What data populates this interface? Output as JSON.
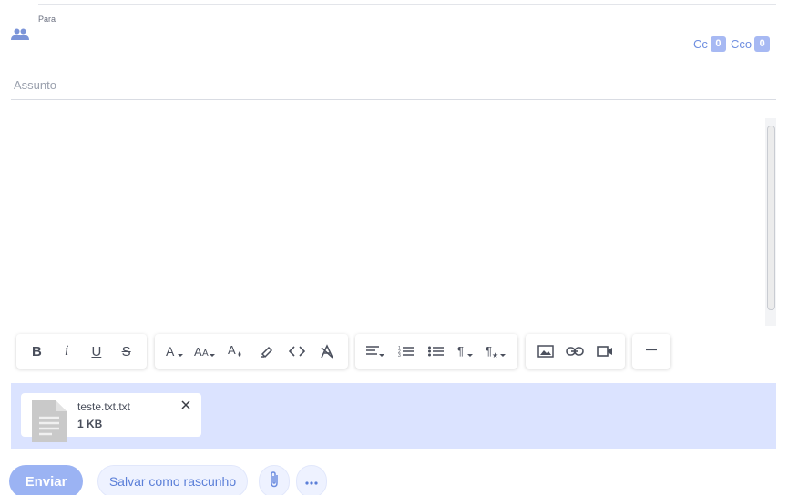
{
  "recipients": {
    "to_label": "Para",
    "to_value": "",
    "cc_label": "Cc",
    "cc_count": "0",
    "bcc_label": "Cco",
    "bcc_count": "0"
  },
  "subject": {
    "placeholder": "Assunto",
    "value": ""
  },
  "body": {
    "value": ""
  },
  "toolbar": {
    "groups": [
      [
        "bold-icon",
        "italic-icon",
        "underline-icon",
        "strikethrough-icon"
      ],
      [
        "font-color-icon",
        "font-size-icon",
        "fill-color-icon",
        "highlight-icon",
        "code-icon",
        "clear-format-icon"
      ],
      [
        "align-icon",
        "ordered-list-icon",
        "bullet-list-icon",
        "paragraph-icon",
        "paragraph-style-icon"
      ],
      [
        "image-icon",
        "link-icon",
        "video-icon"
      ],
      [
        "horizontal-rule-icon"
      ]
    ]
  },
  "attachments": [
    {
      "name": "teste.txt.txt",
      "size": "1 KB"
    }
  ],
  "actions": {
    "send_label": "Enviar",
    "draft_label": "Salvar como rascunho"
  },
  "colors": {
    "accent": "#6e8ee0",
    "send_button": "#9bb3f3",
    "attachment_area": "#dbe3ff"
  }
}
